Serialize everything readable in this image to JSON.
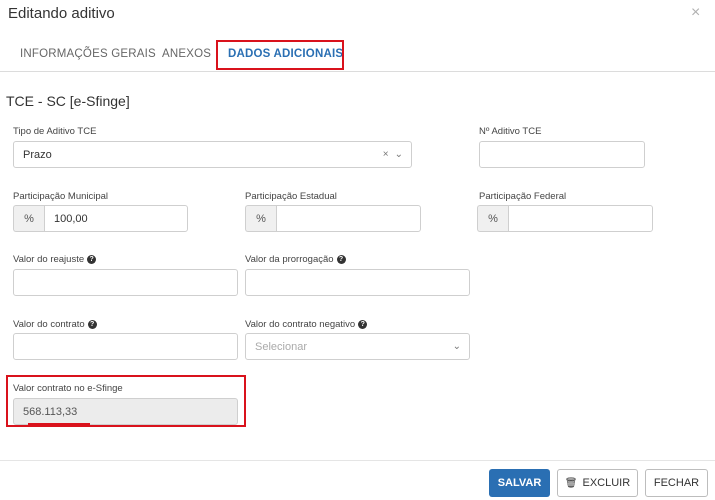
{
  "modal": {
    "title": "Editando aditivo",
    "close_glyph": "×"
  },
  "tabs": [
    {
      "label": "INFORMAÇÕES GERAIS",
      "active": false
    },
    {
      "label": "ANEXOS",
      "active": false
    },
    {
      "label": "DADOS ADICIONAIS",
      "active": true
    }
  ],
  "section_title": "TCE - SC [e-Sfinge]",
  "fields": {
    "tipo_aditivo": {
      "label": "Tipo de Aditivo TCE",
      "value": "Prazo"
    },
    "numero_aditivo": {
      "label": "Nº Aditivo TCE",
      "value": ""
    },
    "participacao_municipal": {
      "label": "Participação Municipal",
      "addon": "%",
      "value": "100,00"
    },
    "participacao_estadual": {
      "label": "Participação Estadual",
      "addon": "%",
      "value": ""
    },
    "participacao_federal": {
      "label": "Participação Federal",
      "addon": "%",
      "value": ""
    },
    "valor_reajuste": {
      "label": "Valor do reajuste",
      "value": ""
    },
    "valor_prorrogacao": {
      "label": "Valor da prorrogação",
      "value": ""
    },
    "valor_contrato": {
      "label": "Valor do contrato",
      "value": ""
    },
    "valor_contrato_negativo": {
      "label": "Valor do contrato negativo",
      "placeholder": "Selecionar"
    },
    "valor_contrato_esfinge": {
      "label": "Valor contrato no e-Sfinge",
      "value": "568.113,33"
    }
  },
  "footer": {
    "save_label": "SALVAR",
    "delete_label": "EXCLUIR",
    "close_label": "FECHAR"
  },
  "icons": {
    "help": "?",
    "clear": "×",
    "chevron": "⌄",
    "trash": "🗑"
  },
  "colors": {
    "primary": "#2a6fb3",
    "highlight": "#d9121c"
  }
}
